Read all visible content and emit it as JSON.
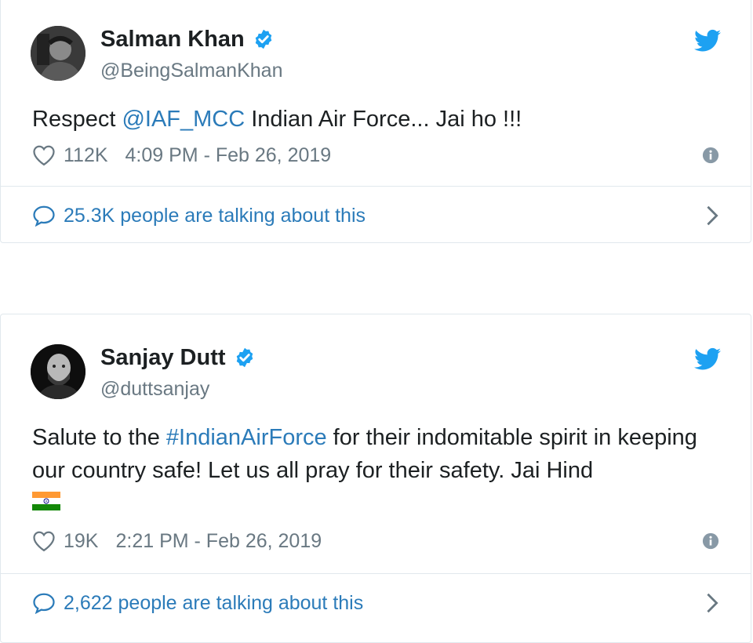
{
  "colors": {
    "link": "#2b7bb9",
    "verified": "#1da1f2",
    "twitter_brand": "#1da1f2",
    "muted": "#697882",
    "border": "#e1e8ed"
  },
  "tweets": [
    {
      "name": "Salman Khan",
      "handle": "@BeingSalmanKhan",
      "verified": true,
      "text_before": "Respect ",
      "mention": "@IAF_MCC",
      "text_after": " Indian Air Force... Jai ho !!!",
      "likes": "112K",
      "timestamp": "4:09 PM - Feb 26, 2019",
      "talking": "25.3K people are talking about this",
      "icons": [
        "avatar",
        "verified-badge-icon",
        "twitter-bird-icon",
        "heart-icon",
        "info-icon",
        "speech-bubble-icon",
        "chevron-right-icon"
      ]
    },
    {
      "name": "Sanjay Dutt",
      "handle": "@duttsanjay",
      "verified": true,
      "text_before": "Salute to the ",
      "hashtag": "#IndianAirForce",
      "text_after": " for their indomitable spirit in keeping our country safe! Let us all pray for their safety. Jai Hind",
      "emoji": "india-flag-icon",
      "likes": "19K",
      "timestamp": "2:21 PM - Feb 26, 2019",
      "talking": "2,622 people are talking about this",
      "icons": [
        "avatar",
        "verified-badge-icon",
        "twitter-bird-icon",
        "heart-icon",
        "info-icon",
        "speech-bubble-icon",
        "chevron-right-icon"
      ]
    }
  ]
}
